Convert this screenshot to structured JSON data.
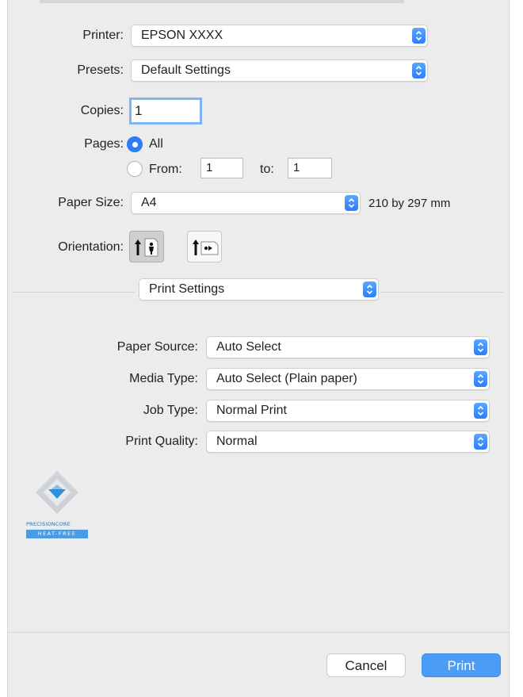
{
  "printer": {
    "label": "Printer:",
    "value": "EPSON XXXX"
  },
  "presets": {
    "label": "Presets:",
    "value": "Default Settings"
  },
  "copies": {
    "label": "Copies:",
    "value": "1"
  },
  "pages": {
    "label": "Pages:",
    "all_label": "All",
    "from_label": "From:",
    "from_value": "1",
    "to_label": "to:",
    "to_value": "1",
    "selected": "All"
  },
  "paper_size": {
    "label": "Paper Size:",
    "value": "A4",
    "dimensions": "210 by 297 mm"
  },
  "orientation": {
    "label": "Orientation:",
    "selected": "portrait"
  },
  "section_menu": {
    "value": "Print Settings"
  },
  "settings": [
    {
      "label": "Paper Source:",
      "value": "Auto Select"
    },
    {
      "label": "Media Type:",
      "value": "Auto Select (Plain paper)"
    },
    {
      "label": "Job Type:",
      "value": "Normal Print"
    },
    {
      "label": "Print Quality:",
      "value": "Normal"
    }
  ],
  "logo": {
    "line1": "PRECISIONCORE",
    "line2": "HEAT-FREE"
  },
  "buttons": {
    "cancel": "Cancel",
    "print": "Print"
  },
  "colors": {
    "accent": "#2f7df6",
    "print_button": "#4b9cf6",
    "background": "#ececec"
  }
}
